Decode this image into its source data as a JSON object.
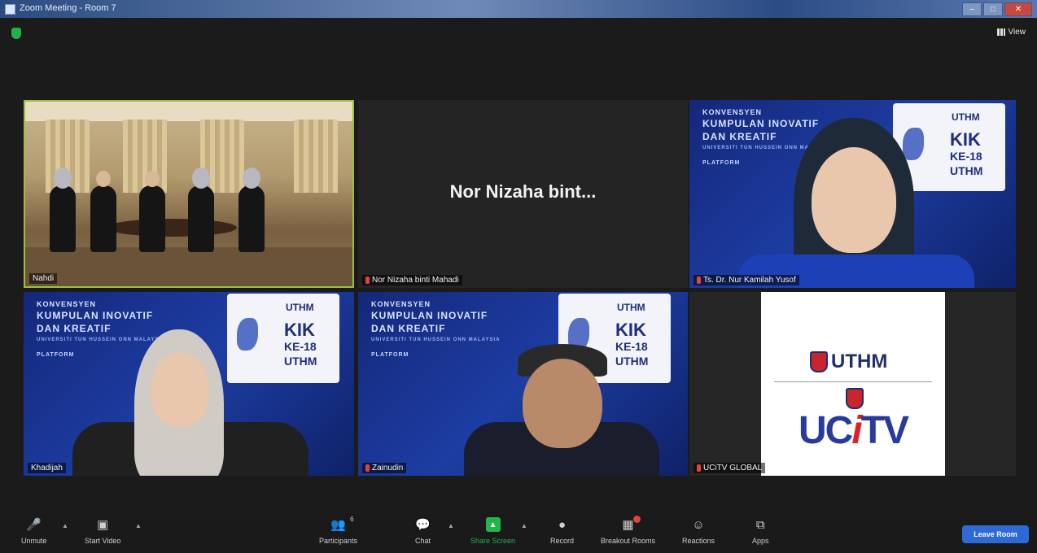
{
  "window": {
    "title": "Zoom Meeting - Room 7"
  },
  "header": {
    "view_label": "View"
  },
  "tiles": [
    {
      "name": "Nahdi"
    },
    {
      "display_name": "Nor Nizaha bint...",
      "name": "Nor Nizaha binti Mahadi"
    },
    {
      "name": "Ts. Dr. Nur Kamilah Yusof"
    },
    {
      "name": "Khadijah"
    },
    {
      "name": "Zainudin"
    },
    {
      "name": "UCiTV GLOBAL"
    }
  ],
  "banner": {
    "line1": "KONVENSYEN",
    "line2": "KUMPULAN INOVATIF",
    "line3": "DAN KREATIF",
    "line4": "UNIVERSITI TUN HUSSEIN ONN MALAYSIA",
    "line5": "PLATFORM",
    "logo_text": "UTHM",
    "kik_1": "KIK",
    "kik_2": "KE-18",
    "kik_3": "UTHM"
  },
  "uctv": {
    "uthm": "UTHM",
    "uc": "UC",
    "i": "i",
    "tv": "TV"
  },
  "toolbar": {
    "unmute": "Unmute",
    "start_video": "Start Video",
    "participants": "Participants",
    "participants_count": "6",
    "chat": "Chat",
    "share_screen": "Share Screen",
    "record": "Record",
    "breakout_rooms": "Breakout Rooms",
    "reactions": "Reactions",
    "apps": "Apps",
    "leave_room": "Leave Room"
  },
  "colors": {
    "active_speaker": "#9ac13b",
    "share_green": "#22b34d",
    "leave_blue": "#2d6ad6",
    "mic_muted": "#e0443b"
  }
}
